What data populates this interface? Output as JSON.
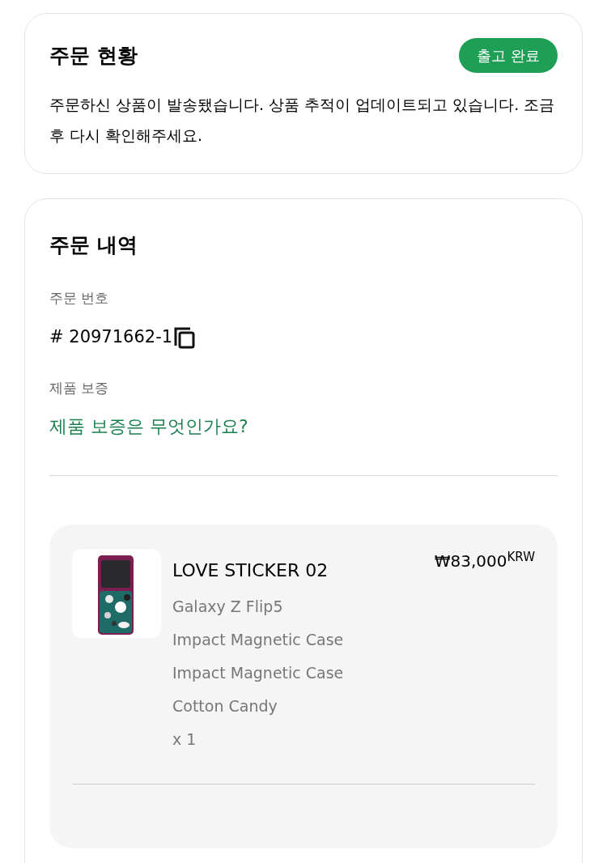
{
  "status_card": {
    "title": "주문 현황",
    "badge": "출고 완료",
    "message": "주문하신 상품이 발송됐습니다. 상품 추적이 업데이트되고 있습니다. 조금 후 다시 확인해주세요."
  },
  "details_card": {
    "title": "주문 내역",
    "order_number_label": "주문 번호",
    "order_number": "# 20971662-1",
    "warranty_label": "제품 보증",
    "warranty_link": "제품 보증은 무엇인가요?",
    "items": [
      {
        "name": "LOVE STICKER 02",
        "price": "₩83,000$^{KRW}$",
        "details": [
          "Galaxy Z Flip5",
          "Impact Magnetic Case",
          "Impact Magnetic Case",
          "Cotton Candy",
          "x 1"
        ]
      }
    ]
  }
}
